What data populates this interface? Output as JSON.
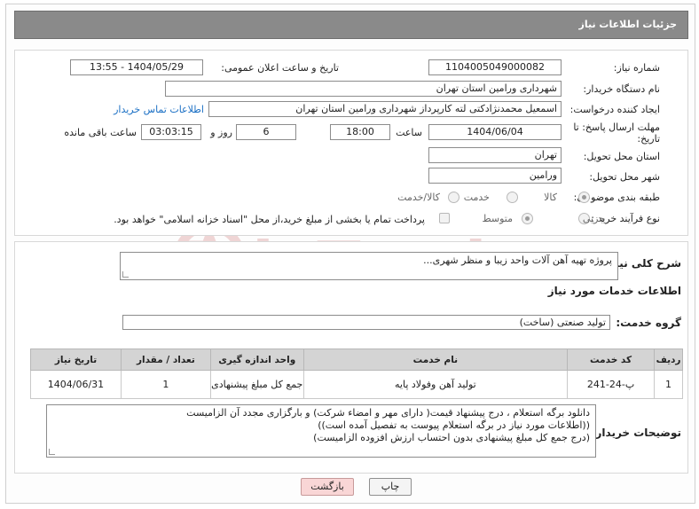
{
  "header": {
    "title": "جزئیات اطلاعات نیاز"
  },
  "fields": {
    "need_number_label": "شماره نیاز:",
    "need_number": "1104005049000082",
    "announce_label": "تاریخ و ساعت اعلان عمومی:",
    "announce_value": "1404/05/29 - 13:55",
    "buyer_org_label": "نام دستگاه خریدار:",
    "buyer_org": "شهرداری ورامین استان تهران",
    "creator_label": "ایجاد کننده درخواست:",
    "creator": "اسمعیل محمدنژادکتی لته کارپرداز شهرداری ورامین استان تهران",
    "contact_link": "اطلاعات تماس خریدار",
    "deadline_label_1": "مهلت ارسال پاسخ: تا",
    "deadline_label_2": "تاریخ:",
    "deadline_date": "1404/06/04",
    "time_label": "ساعت",
    "deadline_time": "18:00",
    "days_value": "6",
    "days_label": "روز و",
    "remaining_time": "03:03:15",
    "remaining_label": "ساعت باقی مانده",
    "province_label": "استان محل تحویل:",
    "province": "تهران",
    "city_label": "شهر محل تحویل:",
    "city": "ورامین",
    "category_label": "طبقه بندی موضوعی:",
    "category_options": [
      "کالا",
      "خدمت",
      "کالا/خدمت"
    ],
    "process_label": "نوع فرآیند خرید :",
    "process_options": [
      "جزیی",
      "متوسط"
    ],
    "payment_note": "پرداخت تمام یا بخشی از مبلغ خرید،از محل \"اسناد خزانه اسلامی\" خواهد بود."
  },
  "summary": {
    "label": "شرح کلی نیاز:",
    "value": "پروژه تهیه آهن آلات واحد زیبا و منظر شهری..."
  },
  "services": {
    "section_title": "اطلاعات خدمات مورد نیاز",
    "group_label": "گروه خدمت:",
    "group_value": "تولید صنعتی (ساخت)",
    "columns": [
      "ردیف",
      "کد خدمت",
      "نام خدمت",
      "واحد اندازه گیری",
      "تعداد / مقدار",
      "تاریخ نیاز"
    ],
    "rows": [
      {
        "index": "1",
        "code": "پ-24-241",
        "name": "تولید آهن وفولاد پایه",
        "unit": "جمع کل مبلغ پیشنهادی",
        "qty": "1",
        "date": "1404/06/31"
      }
    ]
  },
  "buyer_notes": {
    "label": "توضیحات خریدار:",
    "lines": [
      "دانلود برگه استعلام ، درج پیشنهاد قیمت( دارای مهر و امضاء شرکت) و بارگزاری مجدد آن الزامیست",
      "((اطلاعات مورد نیاز در برگه استعلام پیوست به تفصیل آمده است))",
      "(درج  جمع کل مبلغ پیشنهادی بدون احتساب ارزش افزوده الزامیست)"
    ]
  },
  "buttons": {
    "print": "چاپ",
    "back": "بازگشت"
  },
  "watermark": {
    "text": "AriaTender.neT"
  },
  "colors": {
    "header_bg": "#8a8a8a",
    "link": "#1a6fc4",
    "back_btn": "#f9d6d6",
    "table_head": "#d4d4d4",
    "watermark": "#e2b4b4"
  }
}
